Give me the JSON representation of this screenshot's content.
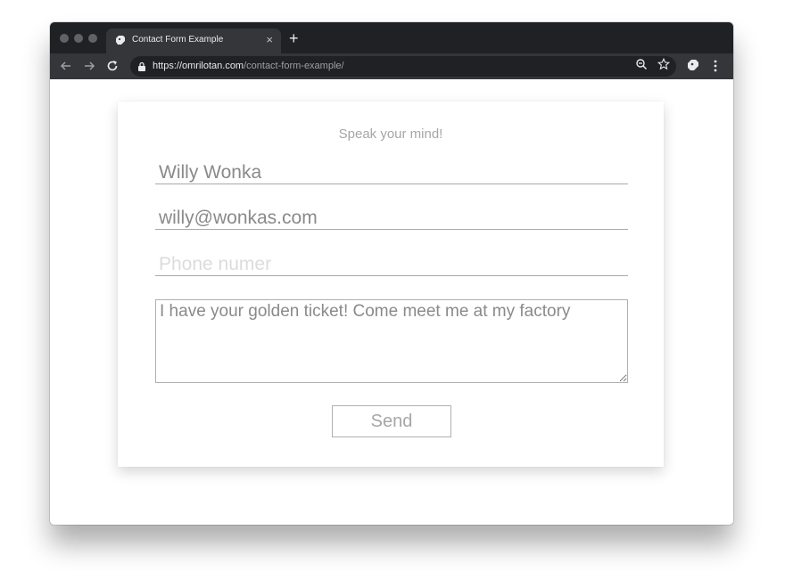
{
  "browser": {
    "tab_title": "Contact Form Example",
    "tab_close": "×",
    "new_tab": "+",
    "url_domain": "https://omrilotan.com",
    "url_path": "/contact-form-example/"
  },
  "form": {
    "heading": "Speak your mind!",
    "name_value": "Willy Wonka",
    "email_value": "willy@wonkas.com",
    "phone_placeholder": "Phone numer",
    "message_value": "I have your golden ticket! Come meet me at my factory",
    "send_label": "Send"
  },
  "colors": {
    "titlebar": "#202124",
    "toolbar": "#35363a",
    "form_text": "#8a8a8a",
    "placeholder": "#dcdcdc"
  }
}
